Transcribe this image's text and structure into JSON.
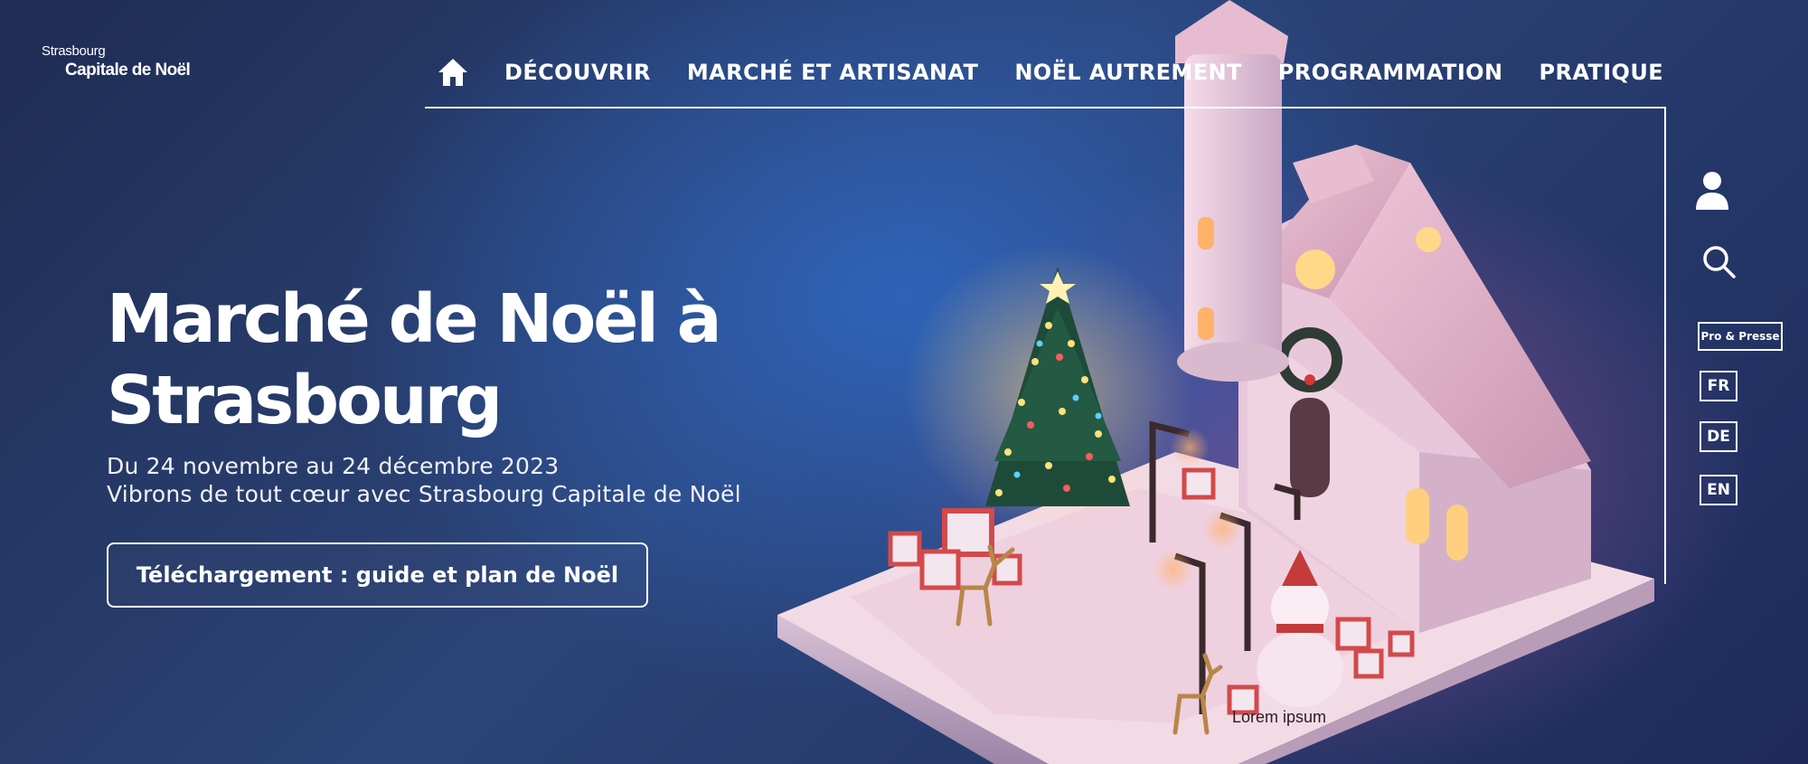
{
  "logo": {
    "line1": "Strasbourg",
    "line2": "Capitale de Noël"
  },
  "nav": {
    "home_icon": "home-icon",
    "items": [
      {
        "label": "DÉCOUVRIR"
      },
      {
        "label": "MARCHÉ ET ARTISANAT"
      },
      {
        "label": "NOËL AUTREMENT"
      },
      {
        "label": "PROGRAMMATION"
      },
      {
        "label": "PRATIQUE"
      }
    ]
  },
  "utility": {
    "user_icon": "user-icon",
    "search_icon": "search-icon",
    "pro_label": "Pro & Presse",
    "languages": [
      "FR",
      "DE",
      "EN"
    ]
  },
  "hero": {
    "title_line1": "Marché de Noël à",
    "title_line2": "Strasbourg",
    "subtitle_line1": "Du 24 novembre au 24 décembre 2023",
    "subtitle_line2": "Vibrons de tout cœur avec Strasbourg Capitale de Noël",
    "cta_label": "Téléchargement : guide et plan de Noël"
  },
  "illustration": {
    "caption": "Lorem ipsum"
  },
  "colors": {
    "background_dark": "#1f2c53",
    "background_glow": "#2f63b8",
    "text": "#ffffff",
    "snow": "#f3dbe6"
  }
}
